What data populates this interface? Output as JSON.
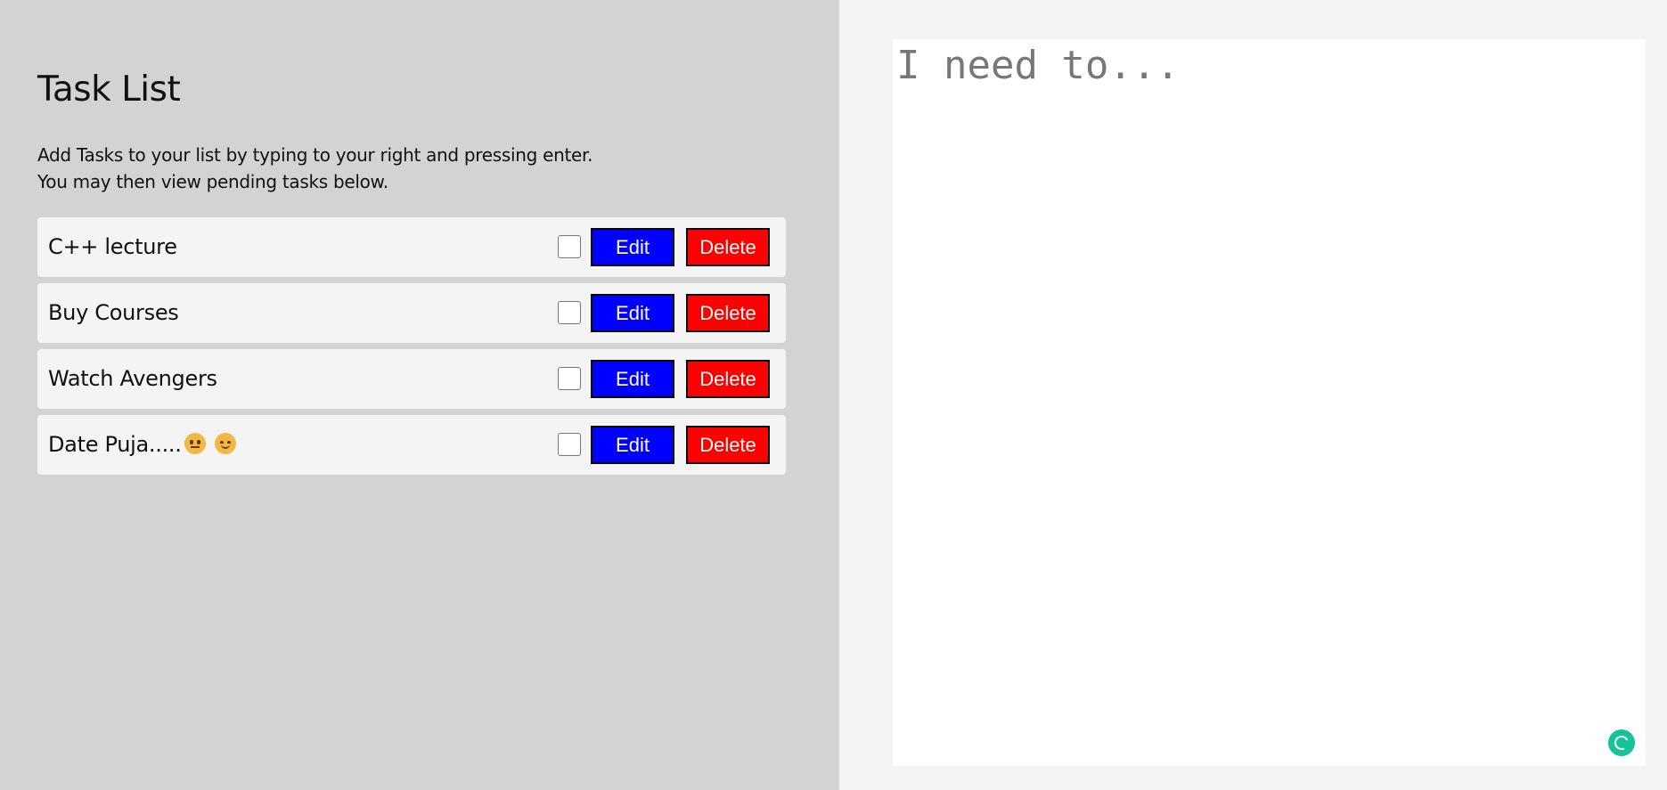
{
  "header": {
    "title": "Task List",
    "instructions_line1": "Add Tasks to your list by typing to your right and pressing enter.",
    "instructions_line2": "You may then view pending tasks below."
  },
  "tasks": [
    {
      "label": "C++ lecture",
      "checked": false,
      "edit_label": "Edit",
      "delete_label": "Delete"
    },
    {
      "label": "Buy Courses",
      "checked": false,
      "edit_label": "Edit",
      "delete_label": "Delete"
    },
    {
      "label": "Watch Avengers",
      "checked": false,
      "edit_label": "Edit",
      "delete_label": "Delete"
    },
    {
      "label": "Date Puja.....",
      "emojis": [
        "neutral-face-emoji",
        "smiling-face-emoji"
      ],
      "checked": false,
      "edit_label": "Edit",
      "delete_label": "Delete"
    }
  ],
  "input": {
    "placeholder": "I need to...",
    "value": ""
  },
  "icons": {
    "assistant": "grammar-assistant-icon"
  },
  "colors": {
    "edit_button": "#0000ff",
    "delete_button": "#ff0000",
    "left_panel": "#d3d3d3",
    "assistant_icon": "#15c39a"
  }
}
